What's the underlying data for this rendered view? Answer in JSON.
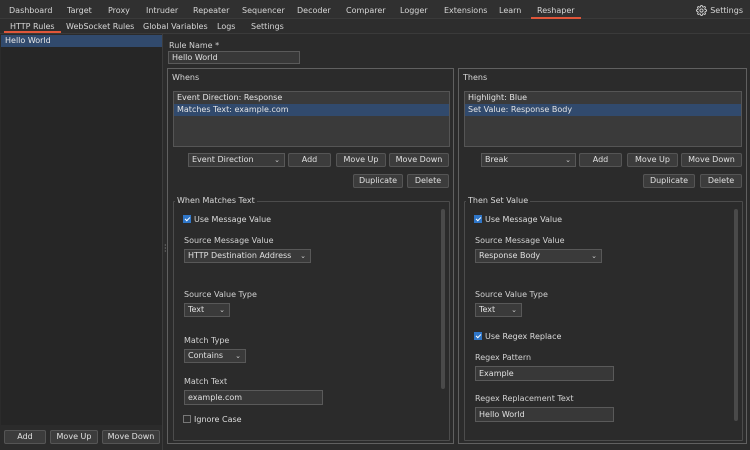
{
  "menu": {
    "items": [
      "Dashboard",
      "Target",
      "Proxy",
      "Intruder",
      "Repeater",
      "Sequencer",
      "Decoder",
      "Comparer",
      "Logger",
      "Extensions",
      "Learn",
      "Reshaper"
    ],
    "active": "Reshaper",
    "settings_label": "Settings",
    "settings_icon": "gear-icon"
  },
  "subtabs": {
    "items": [
      "HTTP Rules",
      "WebSocket Rules",
      "Global Variables",
      "Logs",
      "Settings"
    ],
    "active": "HTTP Rules"
  },
  "rules": {
    "items": [
      "Hello World"
    ],
    "selected": "Hello World",
    "add_label": "Add",
    "move_up_label": "Move Up",
    "move_down_label": "Move Down"
  },
  "rule_name": {
    "label": "Rule Name *",
    "value": "Hello World"
  },
  "whens": {
    "title": "Whens",
    "items": [
      "Event Direction: Response",
      "Matches Text: example.com"
    ],
    "selected_index": 1,
    "type_select": "Event Direction",
    "add_label": "Add",
    "move_up_label": "Move Up",
    "move_down_label": "Move Down",
    "duplicate_label": "Duplicate",
    "delete_label": "Delete",
    "detail": {
      "title": "When Matches Text",
      "use_message_value_label": "Use Message Value",
      "use_message_value": true,
      "source_message_value_label": "Source Message Value",
      "source_message_value": "HTTP Destination Address",
      "source_value_type_label": "Source Value Type",
      "source_value_type": "Text",
      "match_type_label": "Match Type",
      "match_type": "Contains",
      "match_text_label": "Match Text",
      "match_text": "example.com",
      "ignore_case_label": "Ignore Case",
      "ignore_case": false
    }
  },
  "thens": {
    "title": "Thens",
    "items": [
      "Highlight: Blue",
      "Set Value: Response Body"
    ],
    "selected_index": 1,
    "type_select": "Break",
    "add_label": "Add",
    "move_up_label": "Move Up",
    "move_down_label": "Move Down",
    "duplicate_label": "Duplicate",
    "delete_label": "Delete",
    "detail": {
      "title": "Then Set Value",
      "use_message_value_label": "Use Message Value",
      "use_message_value": true,
      "source_message_value_label": "Source Message Value",
      "source_message_value": "Response Body",
      "source_value_type_label": "Source Value Type",
      "source_value_type": "Text",
      "use_regex_replace_label": "Use Regex Replace",
      "use_regex_replace": true,
      "regex_pattern_label": "Regex Pattern",
      "regex_pattern": "Example",
      "regex_replacement_label": "Regex Replacement Text",
      "regex_replacement": "Hello World"
    }
  },
  "colors": {
    "accent": "#e0563a",
    "selection": "#314a6d",
    "checkbox": "#2f76c8"
  }
}
